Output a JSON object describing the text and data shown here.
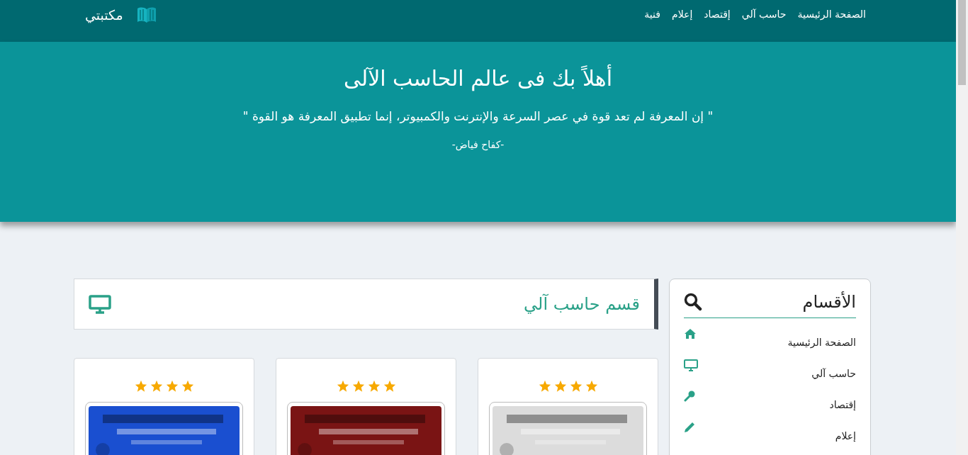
{
  "navbar": {
    "brand": "مكتبتي",
    "links": [
      {
        "label": "الصفحة الرئيسية"
      },
      {
        "label": "حاسب آلي"
      },
      {
        "label": "إقتصاد"
      },
      {
        "label": "إعلام"
      },
      {
        "label": "فنية"
      }
    ]
  },
  "hero": {
    "title": "أهلاً بك فى عالم الحاسب الآلى",
    "quote": "\" إن المعرفة لم تعد قوة في عصر السرعة والإنترنت والكمبيوتر، إنما تطبيق المعرفة هو القوة \"",
    "author": "-كفاح فياض-"
  },
  "section": {
    "title": "قسم حاسب آلي"
  },
  "books": [
    {
      "stars": 4
    },
    {
      "stars": 4
    },
    {
      "stars": 4
    }
  ],
  "sidebar": {
    "title": "الأقسام",
    "items": [
      {
        "label": "الصفحة الرئيسية",
        "kind": "home"
      },
      {
        "label": "حاسب آلي",
        "kind": "computer"
      },
      {
        "label": "إقتصاد",
        "kind": "key"
      },
      {
        "label": "إعلام",
        "kind": "pencil"
      }
    ]
  }
}
